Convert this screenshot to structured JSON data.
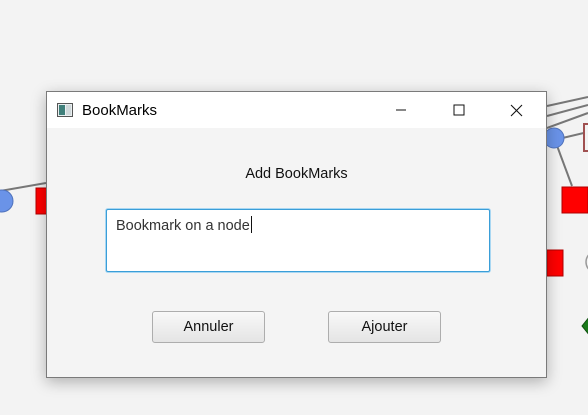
{
  "window": {
    "title": "BookMarks",
    "icon": "bookmark-app-icon",
    "controls": [
      "minimize-icon",
      "maximize-icon",
      "close-icon"
    ]
  },
  "dialog": {
    "heading": "Add BookMarks",
    "input_value": "Bookmark on a node",
    "cancel_label": "Annuler",
    "add_label": "Ajouter"
  },
  "background_graph": {
    "node_colors": {
      "circle": "#6a93e8",
      "square": "#ff0000",
      "diamond": "#1a7a1a",
      "outline_square": "#a05050"
    }
  },
  "colors": {
    "accent": "#3a9ed8",
    "desktop": "#f3f3f3"
  }
}
